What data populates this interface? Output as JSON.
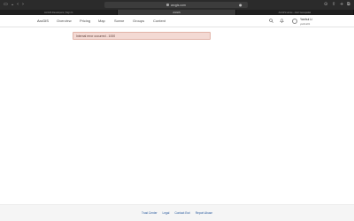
{
  "browser": {
    "url": "arcgis.com",
    "tabs": [
      {
        "label": "ArcGIS Developers | Sign In",
        "active": false
      },
      {
        "label": "ArcGIS",
        "active": true
      },
      {
        "label": "ArcGIS Home – Esri Geospatial",
        "active": false
      }
    ]
  },
  "header": {
    "nav": [
      {
        "label": "ArcGIS"
      },
      {
        "label": "Overview"
      },
      {
        "label": "Pricing"
      },
      {
        "label": "Map"
      },
      {
        "label": "Scene"
      },
      {
        "label": "Groups"
      },
      {
        "label": "Content"
      }
    ],
    "user_name": "Yanhui Li",
    "user_org": "yanhui01"
  },
  "main": {
    "error_message": "Internal error occurred - 1000"
  },
  "footer": {
    "links": [
      {
        "label": "Trust Center"
      },
      {
        "label": "Legal"
      },
      {
        "label": "Contact Esri"
      },
      {
        "label": "Report Abuse"
      }
    ]
  },
  "colors": {
    "error_bg": "#f3d9d3",
    "error_border": "#e1b3a8",
    "link": "#2a5b9e"
  }
}
